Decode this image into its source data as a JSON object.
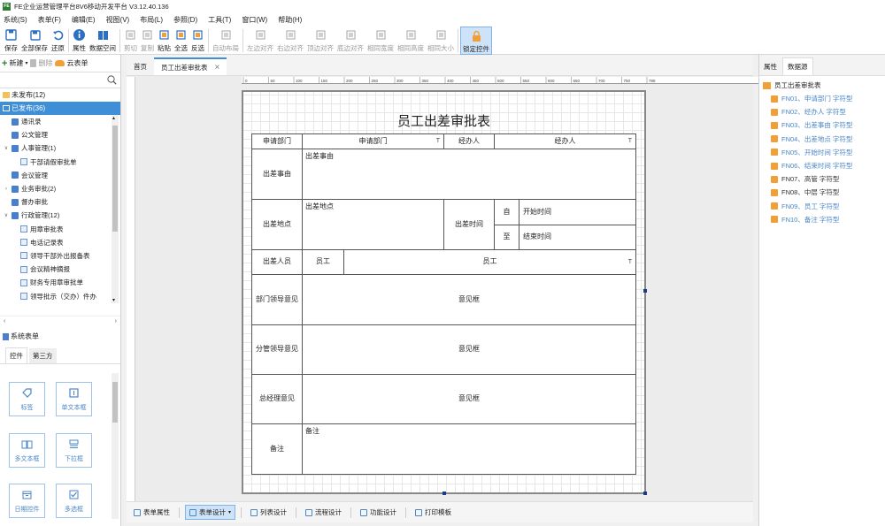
{
  "window": {
    "title": "FE企业运营管理平台8V6移动开发平台 V3.12.40.136",
    "logo": "FE"
  },
  "menu": [
    "系统(S)",
    "表单(F)",
    "编辑(E)",
    "视图(V)",
    "布局(L)",
    "参照(D)",
    "工具(T)",
    "窗口(W)",
    "帮助(H)"
  ],
  "toolbar": {
    "items": [
      {
        "label": "保存",
        "icon": "save-icon",
        "enabled": true
      },
      {
        "label": "全部保存",
        "icon": "save-all-icon",
        "enabled": true
      },
      {
        "label": "还原",
        "icon": "undo-icon",
        "enabled": true
      },
      {
        "label": "属性",
        "icon": "info-icon",
        "enabled": true
      },
      {
        "label": "数据空间",
        "icon": "book-icon",
        "enabled": true
      },
      {
        "label": "剪切",
        "icon": "cut-icon",
        "enabled": false
      },
      {
        "label": "复制",
        "icon": "copy-icon",
        "enabled": false
      },
      {
        "label": "粘贴",
        "icon": "paste-icon",
        "enabled": true
      },
      {
        "label": "全选",
        "icon": "select-all-icon",
        "enabled": true
      },
      {
        "label": "反选",
        "icon": "invert-select-icon",
        "enabled": true
      },
      {
        "label": "自动布局",
        "icon": "auto-layout-icon",
        "enabled": false
      },
      {
        "label": "左边对齐",
        "icon": "align-left-icon",
        "enabled": false
      },
      {
        "label": "右边对齐",
        "icon": "align-right-icon",
        "enabled": false
      },
      {
        "label": "顶边对齐",
        "icon": "align-top-icon",
        "enabled": false
      },
      {
        "label": "底边对齐",
        "icon": "align-bottom-icon",
        "enabled": false
      },
      {
        "label": "相同宽度",
        "icon": "same-width-icon",
        "enabled": false
      },
      {
        "label": "相同高度",
        "icon": "same-height-icon",
        "enabled": false
      },
      {
        "label": "相同大小",
        "icon": "same-size-icon",
        "enabled": false
      },
      {
        "label": "锁定控件",
        "icon": "lock-icon",
        "enabled": true,
        "active": true
      }
    ]
  },
  "left": {
    "new_label": "新建",
    "delete_label": "删除",
    "cloud_label": "云表单",
    "search_placeholder": "",
    "unpublished": "未发布(12)",
    "published": "已发布(36)",
    "system": "系统表单",
    "tree": [
      {
        "label": "通讯录",
        "kind": "doc",
        "indent": 0,
        "toggle": ""
      },
      {
        "label": "公文管理",
        "kind": "doc",
        "indent": 0,
        "toggle": ""
      },
      {
        "label": "人事管理(1)",
        "kind": "doc",
        "indent": 0,
        "toggle": "∨"
      },
      {
        "label": "干部请假审批单",
        "kind": "form",
        "indent": 1,
        "toggle": ""
      },
      {
        "label": "会议管理",
        "kind": "doc",
        "indent": 0,
        "toggle": ""
      },
      {
        "label": "业务审批(2)",
        "kind": "doc",
        "indent": 0,
        "toggle": "›"
      },
      {
        "label": "督办审批",
        "kind": "doc",
        "indent": 0,
        "toggle": ""
      },
      {
        "label": "行政管理(12)",
        "kind": "doc",
        "indent": 0,
        "toggle": "∨"
      },
      {
        "label": "用章审批表",
        "kind": "form",
        "indent": 1,
        "toggle": ""
      },
      {
        "label": "电话记录表",
        "kind": "form",
        "indent": 1,
        "toggle": ""
      },
      {
        "label": "领导干部外出报备表",
        "kind": "form",
        "indent": 1,
        "toggle": ""
      },
      {
        "label": "会议精神摘报",
        "kind": "form",
        "indent": 1,
        "toggle": ""
      },
      {
        "label": "财务专用章审批单",
        "kind": "form",
        "indent": 1,
        "toggle": ""
      },
      {
        "label": "领导批示（交办）件办",
        "kind": "form",
        "indent": 1,
        "toggle": ""
      }
    ],
    "panel_tabs": [
      "控件",
      "第三方"
    ],
    "controls": [
      {
        "label": "标签",
        "icon": "tag-icon"
      },
      {
        "label": "单文本框",
        "icon": "single-text-icon"
      },
      {
        "label": "多文本框",
        "icon": "multi-text-icon"
      },
      {
        "label": "下拉框",
        "icon": "dropdown-icon"
      },
      {
        "label": "日期控件",
        "icon": "calendar-icon"
      },
      {
        "label": "多选框",
        "icon": "checkbox-icon"
      }
    ]
  },
  "doc_tabs": [
    "首页",
    "员工出差审批表"
  ],
  "ruler_marks": [
    "0",
    "50",
    "100",
    "150",
    "200",
    "250",
    "300",
    "350",
    "400",
    "450",
    "500",
    "550",
    "600",
    "650",
    "700",
    "750",
    "788"
  ],
  "form": {
    "title": "员工出差审批表",
    "dept_label": "申请部门",
    "dept_field": "申请部门",
    "handler_label": "经办人",
    "handler_field": "经办人",
    "reason_label": "出差事由",
    "reason_field": "出差事由",
    "place_label": "出差地点",
    "place_field": "出差地点",
    "time_label": "出差时间",
    "from_label": "自",
    "from_field": "开始时间",
    "to_label": "至",
    "to_field": "结束时间",
    "staff_label": "出差人员",
    "staff_sub": "员工",
    "staff_field": "员工",
    "dept_opinion_label": "部门领导意见",
    "sub_opinion_label": "分管领导意见",
    "gm_opinion_label": "总经理意见",
    "opinion_field": "意见框",
    "remark_label": "备注",
    "remark_field": "备注",
    "text_marker": "T"
  },
  "bottom_tabs": [
    {
      "label": "表单属性",
      "active": false
    },
    {
      "label": "表单设计",
      "active": true
    },
    {
      "label": "列表设计",
      "active": false
    },
    {
      "label": "流程设计",
      "active": false
    },
    {
      "label": "功能设计",
      "active": false
    },
    {
      "label": "打印模板",
      "active": false
    }
  ],
  "right": {
    "tabs": [
      "属性",
      "数据源"
    ],
    "root": "员工出差审批表",
    "fields": [
      {
        "label": "FN01、申请部门 字符型",
        "bound": true
      },
      {
        "label": "FN02、经办人 字符型",
        "bound": true
      },
      {
        "label": "FN03、出差事由 字符型",
        "bound": true
      },
      {
        "label": "FN04、出差地点 字符型",
        "bound": true
      },
      {
        "label": "FN05、开始时间 字符型",
        "bound": true
      },
      {
        "label": "FN06、结束时间 字符型",
        "bound": true
      },
      {
        "label": "FN07、高管 字符型",
        "bound": false
      },
      {
        "label": "FN08、中层 字符型",
        "bound": false
      },
      {
        "label": "FN09、员工 字符型",
        "bound": true
      },
      {
        "label": "FN10、备注 字符型",
        "bound": true
      }
    ]
  },
  "colors": {
    "accent": "#3f8fd8",
    "bound_field": "#4a86c8",
    "unbound_field": "#333333",
    "lock_active": "#f1a037"
  }
}
